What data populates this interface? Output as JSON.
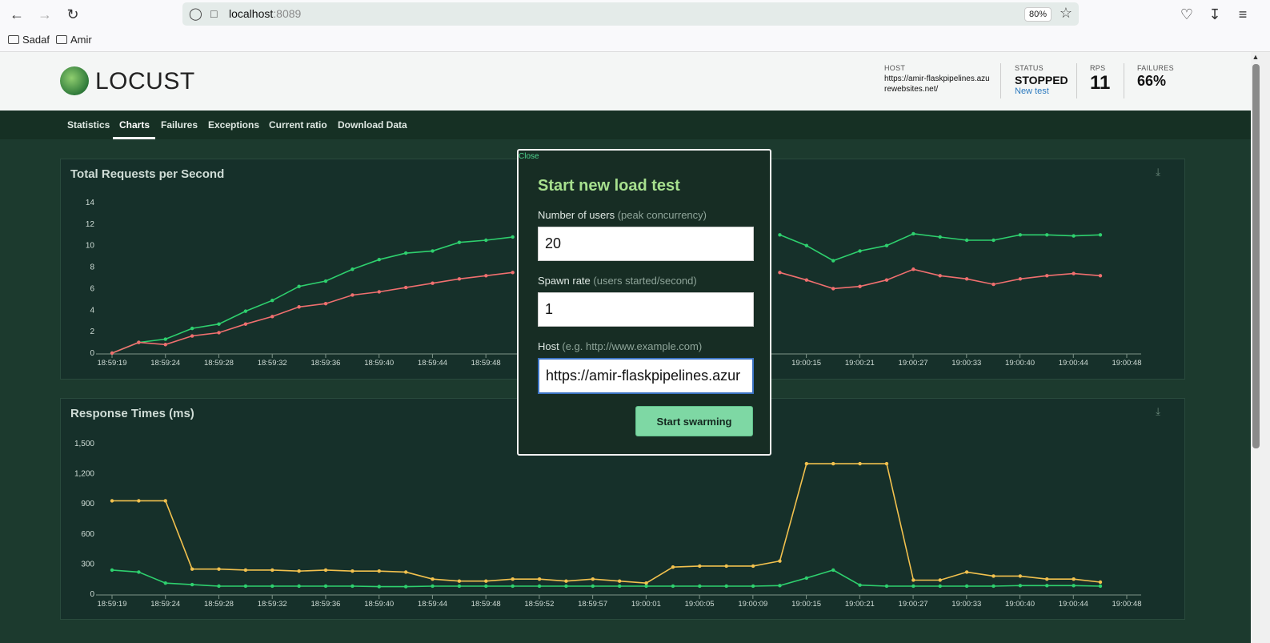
{
  "browser": {
    "url_host": "localhost",
    "url_port": ":8089",
    "zoom": "80%",
    "bookmarks": [
      "Sadaf",
      "Amir"
    ]
  },
  "header": {
    "logo_text": "LOCUST",
    "host_label": "HOST",
    "host_value": "https://amir-flaskpipelines.azurewebsites.net/",
    "status_label": "STATUS",
    "status_value": "STOPPED",
    "new_test": "New test",
    "rps_label": "RPS",
    "rps_value": "11",
    "failures_label": "FAILURES",
    "failures_value": "66%"
  },
  "nav": {
    "tabs": [
      "Statistics",
      "Charts",
      "Failures",
      "Exceptions",
      "Current ratio",
      "Download Data"
    ],
    "active": "Charts"
  },
  "modal": {
    "close": "Close",
    "title": "Start new load test",
    "users_label": "Number of users",
    "users_hint": "(peak concurrency)",
    "users_value": "20",
    "spawn_label": "Spawn rate",
    "spawn_hint": "(users started/second)",
    "spawn_value": "1",
    "host_label": "Host",
    "host_hint": "(e.g. http://www.example.com)",
    "host_value": "https://amir-flaskpipelines.azur",
    "start_button": "Start swarming"
  },
  "colors": {
    "green_line": "#2ed06e",
    "red_line": "#f06f6f",
    "yellow_line": "#f2c14e",
    "panel_bg": "#16302a"
  },
  "chart_data": [
    {
      "type": "line",
      "title": "Total Requests per Second",
      "ylim": [
        0,
        14
      ],
      "yticks": [
        "0",
        "2",
        "4",
        "6",
        "8",
        "10",
        "12",
        "14"
      ],
      "xtick_labels": [
        "18:59:19",
        "18:59:24",
        "18:59:28",
        "18:59:32",
        "18:59:36",
        "18:59:40",
        "18:59:44",
        "18:59:48",
        "",
        "",
        "",
        "",
        "",
        "19:00:15",
        "19:00:21",
        "19:00:27",
        "19:00:33",
        "19:00:40",
        "19:00:44",
        "19:00:48"
      ],
      "series": [
        {
          "color": "#2ed06e",
          "values": [
            0,
            1,
            1.3,
            2.3,
            2.7,
            3.9,
            4.9,
            6.2,
            6.7,
            7.8,
            8.7,
            9.3,
            9.5,
            10.3,
            10.5,
            10.8,
            null,
            null,
            null,
            null,
            null,
            null,
            null,
            null,
            null,
            11.0,
            10.0,
            8.6,
            9.5,
            10.0,
            11.1,
            10.8,
            10.5,
            10.5,
            11.0,
            11.0,
            10.9,
            11.0
          ]
        },
        {
          "color": "#f06f6f",
          "values": [
            0,
            1,
            0.8,
            1.6,
            1.9,
            2.7,
            3.4,
            4.3,
            4.6,
            5.4,
            5.7,
            6.1,
            6.5,
            6.9,
            7.2,
            7.5,
            null,
            null,
            null,
            null,
            null,
            null,
            null,
            null,
            null,
            7.5,
            6.8,
            6.0,
            6.2,
            6.8,
            7.8,
            7.2,
            6.9,
            6.4,
            6.9,
            7.2,
            7.4,
            7.2
          ]
        }
      ]
    },
    {
      "type": "line",
      "title": "Response Times (ms)",
      "ylim": [
        0,
        1500
      ],
      "yticks": [
        "0",
        "300",
        "600",
        "900",
        "1,200",
        "1,500"
      ],
      "xtick_labels": [
        "18:59:19",
        "18:59:24",
        "18:59:28",
        "18:59:32",
        "18:59:36",
        "18:59:40",
        "18:59:44",
        "18:59:48",
        "18:59:52",
        "18:59:57",
        "19:00:01",
        "19:00:05",
        "19:00:09",
        "19:00:15",
        "19:00:21",
        "19:00:27",
        "19:00:33",
        "19:00:40",
        "19:00:44",
        "19:00:48"
      ],
      "series": [
        {
          "color": "#f2c14e",
          "values": [
            930,
            930,
            930,
            250,
            250,
            240,
            240,
            230,
            240,
            230,
            230,
            220,
            150,
            130,
            130,
            150,
            150,
            130,
            150,
            130,
            110,
            270,
            280,
            280,
            280,
            330,
            1300,
            1300,
            1300,
            1300,
            140,
            140,
            220,
            180,
            180,
            150,
            150,
            120
          ]
        },
        {
          "color": "#2ed06e",
          "values": [
            240,
            220,
            110,
            95,
            80,
            80,
            80,
            80,
            80,
            80,
            75,
            75,
            80,
            80,
            80,
            80,
            80,
            80,
            80,
            80,
            80,
            80,
            80,
            80,
            80,
            85,
            160,
            240,
            90,
            80,
            80,
            80,
            80,
            80,
            85,
            85,
            85,
            80
          ]
        }
      ]
    }
  ]
}
